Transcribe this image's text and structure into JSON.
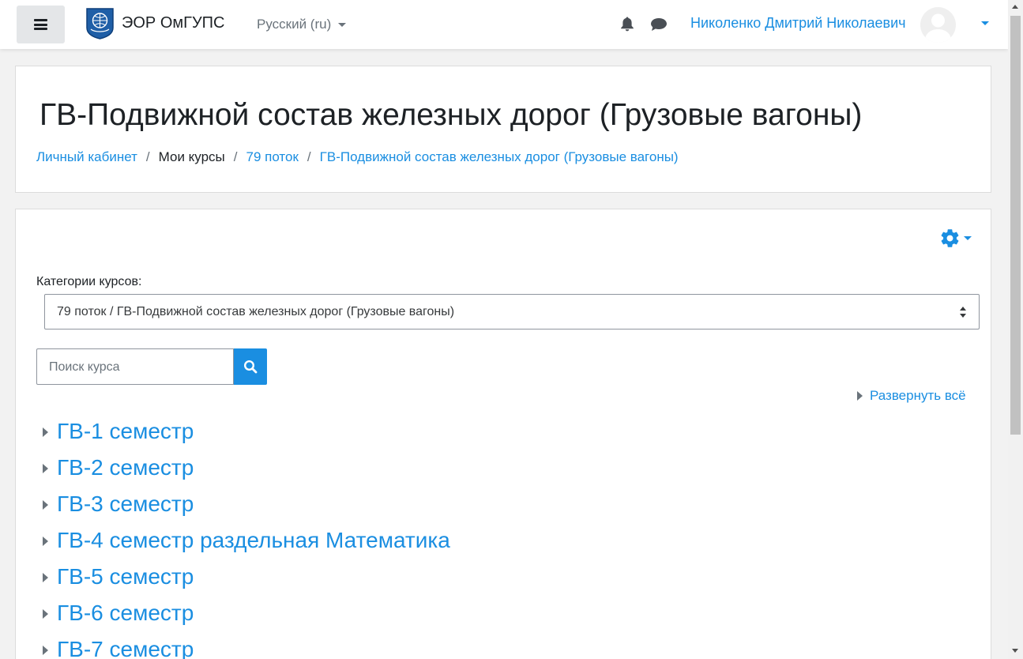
{
  "navbar": {
    "site_name": "ЭОР ОмГУПС",
    "language": "Русский (ru)",
    "user_name": "Николенко Дмитрий Николаевич"
  },
  "header": {
    "title": "ГВ-Подвижной состав железных дорог (Грузовые вагоны)",
    "breadcrumb": [
      {
        "label": "Личный кабинет"
      },
      {
        "label": "Мои курсы"
      },
      {
        "label": "79 поток"
      },
      {
        "label": "ГВ-Подвижной состав железных дорог (Грузовые вагоны)"
      }
    ],
    "separator": "/"
  },
  "main": {
    "categories_label": "Категории курсов:",
    "categories_selected": "79 поток / ГВ-Подвижной состав железных дорог (Грузовые вагоны)",
    "search_placeholder": "Поиск курса",
    "expand_all": "Развернуть всё",
    "categories": [
      {
        "name": "ГВ-1 семестр"
      },
      {
        "name": "ГВ-2 семестр"
      },
      {
        "name": "ГВ-3 семестр"
      },
      {
        "name": "ГВ-4 семестр раздельная Математика"
      },
      {
        "name": "ГВ-5 семестр"
      },
      {
        "name": "ГВ-6 семестр"
      },
      {
        "name": "ГВ-7 семестр"
      }
    ]
  },
  "icons": {
    "menu": "hamburger-icon",
    "logo": "university-logo",
    "notifications": "bell-icon",
    "messages": "chat-icon",
    "avatar": "default-user-avatar",
    "settings": "gear-icon",
    "search": "search-icon"
  },
  "colors": {
    "accent": "#1a8ee1",
    "text": "#1d2125",
    "muted": "#6a737b",
    "background": "#f2f2f2"
  }
}
